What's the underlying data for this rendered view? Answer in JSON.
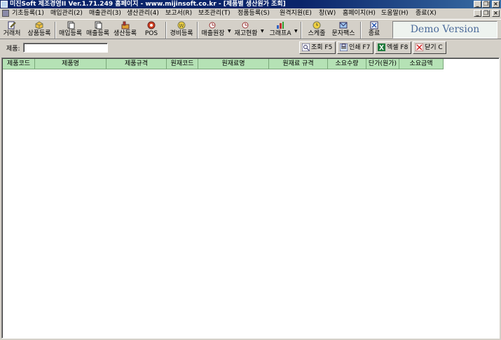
{
  "window": {
    "title": "미진Soft 제조경영II Ver.1.71.249       홈페이지 - www.mijinsoft.co.kr - [제품별 생산원가 조회]"
  },
  "menu": [
    "기초등록(1)",
    "매입관리(2)",
    "매출관리(3)",
    "생산관리(4)",
    "보고서(R)",
    "보조관리(T)",
    "정품등록(S)",
    "원격지원(E)",
    "창(W)",
    "홈페이지(H)",
    "도움말(H)",
    "종료(X)"
  ],
  "toolbar": [
    {
      "label": "거래처",
      "icon": "edit-icon"
    },
    {
      "label": "상품등록",
      "icon": "box-icon"
    },
    {
      "label": "매입등록",
      "icon": "document-icon"
    },
    {
      "label": "매출등록",
      "icon": "document-icon"
    },
    {
      "label": "생산등록",
      "icon": "factory-icon"
    },
    {
      "label": "POS",
      "icon": "pos-icon"
    },
    {
      "label": "경비등록",
      "icon": "coin-icon"
    },
    {
      "label": "매출원장",
      "icon": "ledger-icon"
    },
    {
      "label": "재고현황",
      "icon": "stock-icon"
    },
    {
      "label": "그래프A",
      "icon": "chart-icon"
    },
    {
      "label": "스케줄",
      "icon": "clock-icon"
    },
    {
      "label": "문자팩스",
      "icon": "message-icon"
    },
    {
      "label": "종료",
      "icon": "exit-icon"
    }
  ],
  "demo_label": "Demo Version",
  "filter": {
    "label": "제품:",
    "value": ""
  },
  "actions": [
    {
      "label": "조회 F5",
      "icon": "search-icon"
    },
    {
      "label": "인쇄 F7",
      "icon": "print-icon"
    },
    {
      "label": "엑셀 F8",
      "icon": "excel-icon"
    },
    {
      "label": "닫기 C",
      "icon": "close-icon"
    }
  ],
  "grid": {
    "columns": [
      "제품코드",
      "제품명",
      "제품규격",
      "원재코드",
      "원재료명",
      "원재료 규격",
      "소요수량",
      "단가(원가)",
      "소요금액"
    ],
    "rows": []
  }
}
